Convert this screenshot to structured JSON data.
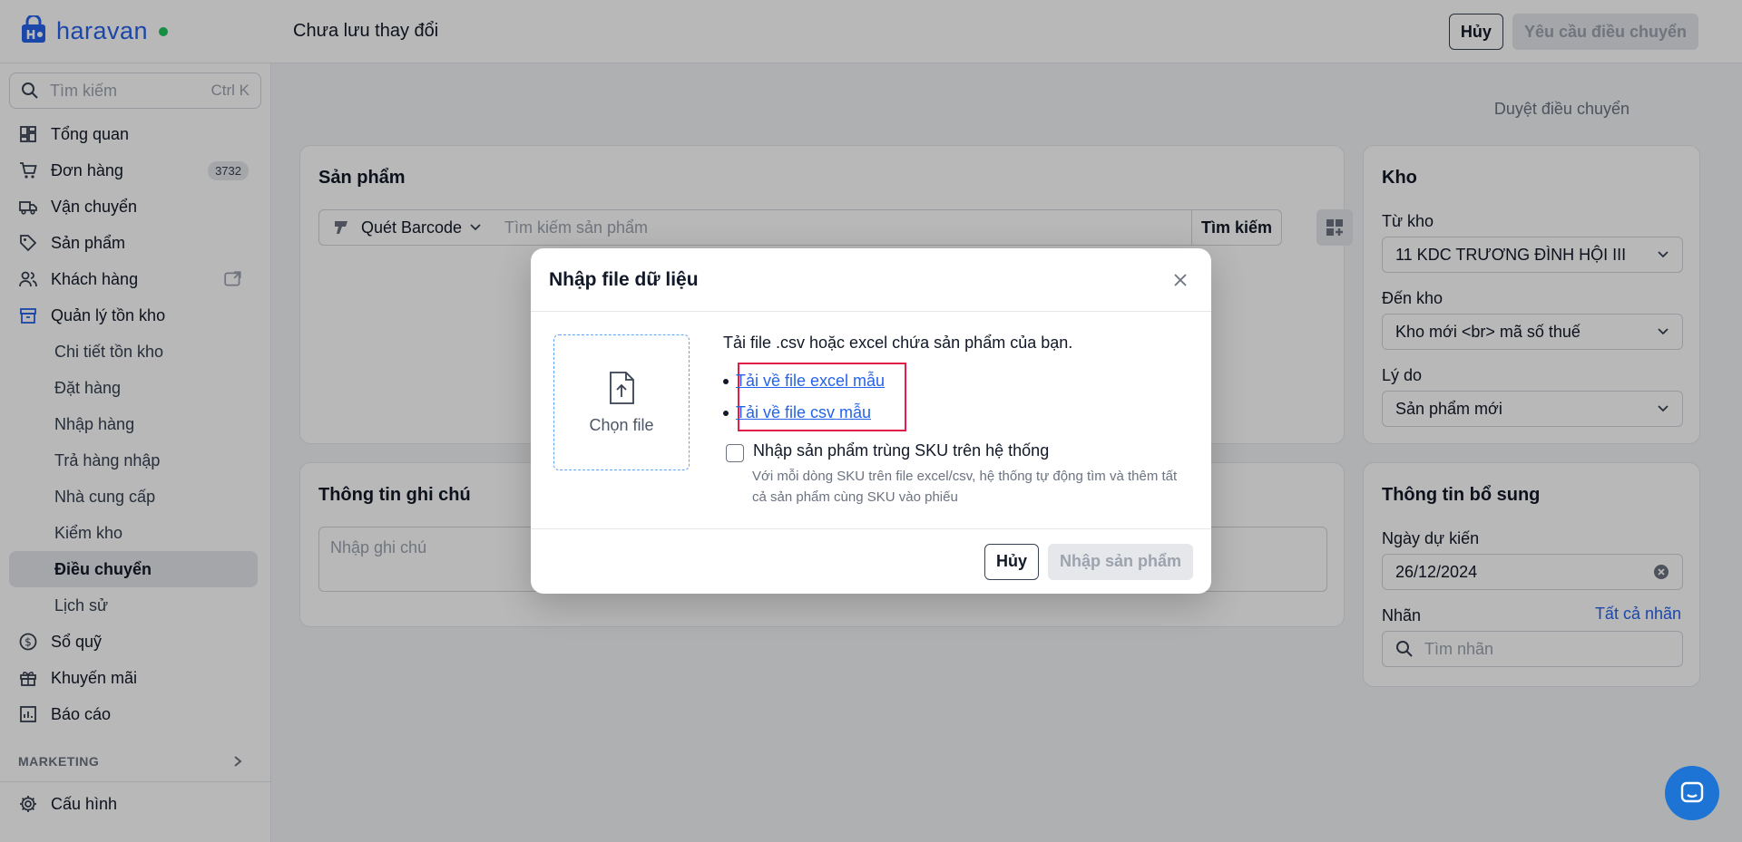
{
  "topbar": {
    "brand": "haravan",
    "title": "Chưa lưu thay đổi",
    "cancel_label": "Hủy",
    "request_label": "Yêu cầu điều chuyển"
  },
  "sidebar": {
    "search_placeholder": "Tìm kiếm",
    "search_shortcut": "Ctrl K",
    "items": [
      {
        "label": "Tổng quan",
        "icon": "dashboard-icon"
      },
      {
        "label": "Đơn hàng",
        "icon": "cart-icon",
        "badge": "3732"
      },
      {
        "label": "Vận chuyển",
        "icon": "truck-icon"
      },
      {
        "label": "Sản phẩm",
        "icon": "tag-icon"
      },
      {
        "label": "Khách hàng",
        "icon": "users-icon"
      },
      {
        "label": "Quản lý tồn kho",
        "icon": "box-icon"
      }
    ],
    "sub_items": [
      "Chi tiết tồn kho",
      "Đặt hàng",
      "Nhập hàng",
      "Trả hàng nhập",
      "Nhà cung cấp",
      "Kiểm kho",
      "Điều chuyển",
      "Lịch sử"
    ],
    "items_after": [
      {
        "label": "Sổ quỹ",
        "icon": "money-icon"
      },
      {
        "label": "Khuyến mãi",
        "icon": "gift-icon"
      },
      {
        "label": "Báo cáo",
        "icon": "chart-icon"
      }
    ],
    "section_marketing": "MARKETING",
    "settings_label": "Cấu hình"
  },
  "main": {
    "approve_label": "Duyệt điều chuyển",
    "products": {
      "title": "Sản phẩm",
      "scan_label": "Quét Barcode",
      "search_placeholder": "Tìm kiếm sản phẩm",
      "search_button": "Tìm kiếm"
    },
    "note": {
      "title": "Thông tin ghi chú",
      "placeholder": "Nhập ghi chú"
    },
    "warehouse": {
      "title": "Kho",
      "from_label": "Từ kho",
      "from_value": "11 KDC TRƯƠNG ĐÌNH HỘI III",
      "to_label": "Đến kho",
      "to_value": "Kho mới <br> mã số thuế",
      "reason_label": "Lý do",
      "reason_value": "Sản phẩm mới"
    },
    "extra": {
      "title": "Thông tin bổ sung",
      "date_label": "Ngày dự kiến",
      "date_value": "26/12/2024",
      "tags_label": "Nhãn",
      "all_tags": "Tất cả nhãn",
      "tags_placeholder": "Tìm nhãn"
    }
  },
  "modal": {
    "title": "Nhập file dữ liệu",
    "choose_file": "Chọn file",
    "description": "Tải file .csv hoặc excel chứa sản phẩm của bạn.",
    "link_excel": "Tải về file excel mẫu",
    "link_csv": "Tải về file csv mẫu",
    "checkbox_label": "Nhập sản phẩm trùng SKU trên hệ thống",
    "checkbox_help": "Với mỗi dòng SKU trên file excel/csv, hệ thống tự động tìm và thêm tất cả sản phẩm cùng SKU vào phiếu",
    "cancel_label": "Hủy",
    "submit_label": "Nhập sản phẩm"
  },
  "colors": {
    "brand": "#2563eb",
    "highlight": "#e11d48",
    "chat": "#1d74d4"
  }
}
